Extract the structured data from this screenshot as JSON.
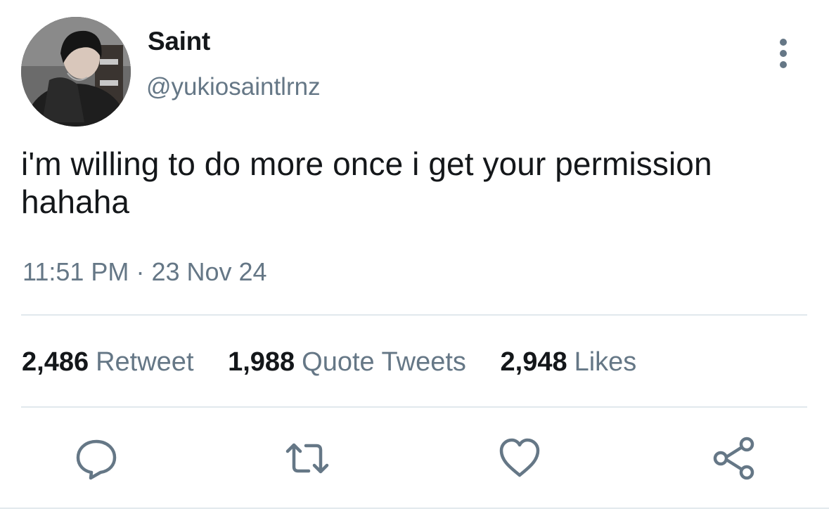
{
  "user": {
    "display_name": "Saint",
    "handle": "@yukiosaintlrnz",
    "avatar_icon": "profile-photo"
  },
  "tweet": {
    "text": "i'm willing to do more once i get your permission hahaha",
    "time": "11:51 PM",
    "separator": "·",
    "date": "23 Nov 24"
  },
  "stats": {
    "retweets_count": "2,486",
    "retweets_label": "Retweet",
    "quotes_count": "1,988",
    "quotes_label": "Quote Tweets",
    "likes_count": "2,948",
    "likes_label": "Likes"
  },
  "actions": [
    {
      "icon": "reply-icon"
    },
    {
      "icon": "retweet-icon"
    },
    {
      "icon": "like-icon"
    },
    {
      "icon": "share-icon"
    }
  ],
  "colors": {
    "text": "#14171a",
    "secondary": "#657786",
    "divider": "#e1e8ed"
  }
}
